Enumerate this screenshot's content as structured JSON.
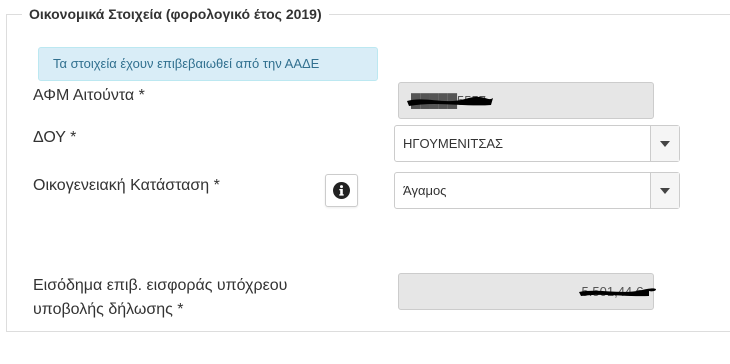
{
  "fieldset": {
    "legend": "Οικονομικά Στοιχεία (φορολογικό έτος 2019)"
  },
  "alert": {
    "text": "Τα στοιχεία έχουν επιβεβαιωθεί από την ΑΑΔΕ"
  },
  "afm": {
    "label": "ΑΦΜ Αιτούντα *",
    "value": "█████5557"
  },
  "doy": {
    "label": "ΔΟΥ *",
    "selected": "ΗΓΟΥΜΕΝΙΤΣΑΣ"
  },
  "marital": {
    "label": "Οικογενειακή Κατάσταση *",
    "info_icon": "info-circle-icon",
    "selected": "Άγαμος"
  },
  "income": {
    "label_line1": "Εισόδημα επιβ. εισφοράς υπόχρεου",
    "label_line2": "υποβολής δήλωσης *",
    "value": "5.501,44 €"
  },
  "colors": {
    "alert_bg": "#d9edf7",
    "alert_text": "#31708f",
    "readonly_bg": "#e6e6e6",
    "redaction": "#000000"
  }
}
